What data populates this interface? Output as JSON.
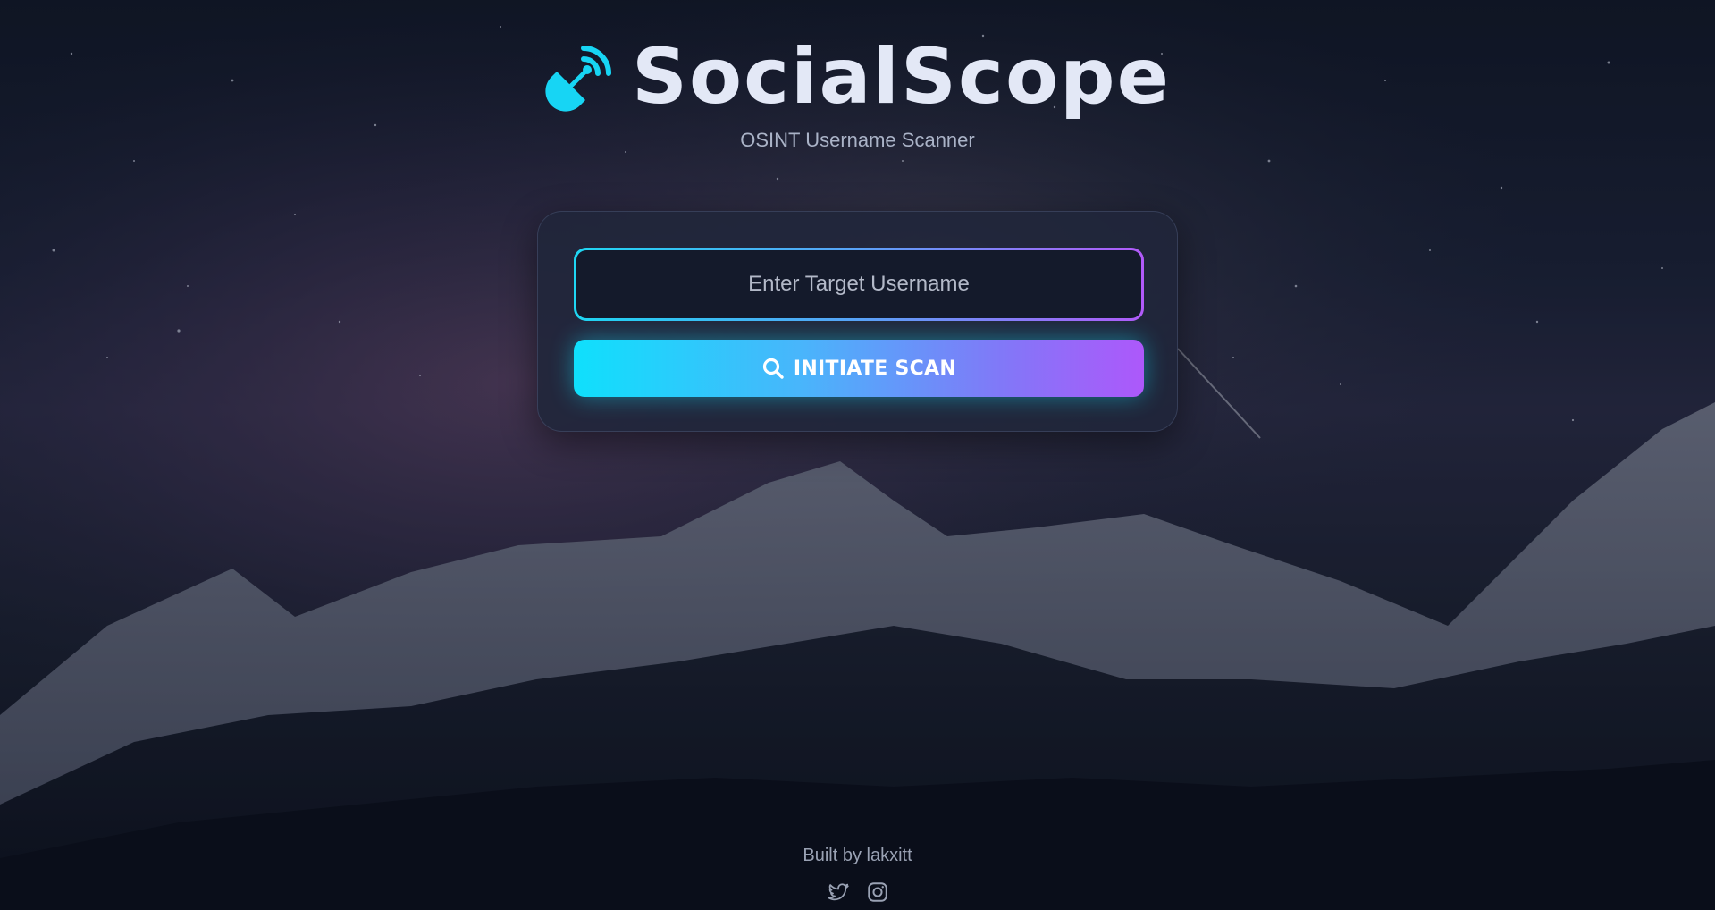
{
  "app": {
    "title": "SocialScope",
    "subtitle": "OSINT Username Scanner",
    "logo_icon": "satellite-dish-icon",
    "accent_colors": {
      "cyan": "#0fe0fc",
      "purple": "#ad58fa",
      "title": "#e3e8f6"
    }
  },
  "search": {
    "placeholder": "Enter Target Username",
    "value": ""
  },
  "scan_button": {
    "label": "INITIATE SCAN",
    "icon": "search-icon"
  },
  "footer": {
    "built_by": "Built by lakxitt",
    "social_icons": [
      "twitter-icon",
      "instagram-icon"
    ]
  }
}
